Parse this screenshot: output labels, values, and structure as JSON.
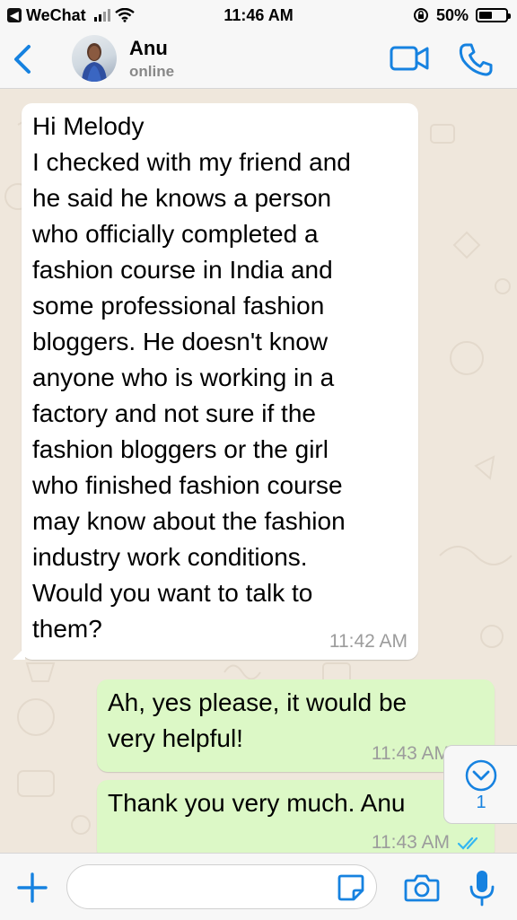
{
  "status_bar": {
    "carrier": "WeChat",
    "time": "11:46 AM",
    "battery": "50%",
    "battery_level": 0.5
  },
  "header": {
    "contact_name": "Anu",
    "contact_status": "online"
  },
  "messages": [
    {
      "direction": "incoming",
      "text": "Hi Melody\nI checked with my friend and\nhe said he knows a person\nwho officially completed a\nfashion course in India and\nsome professional fashion\nbloggers. He doesn't know\nanyone who is working in a\nfactory and not sure if the\nfashion bloggers or the girl\nwho finished fashion course\nmay know about the fashion\nindustry work conditions.\nWould you want to talk to\nthem?",
      "time": "11:42 AM"
    },
    {
      "direction": "outgoing",
      "text": "Ah, yes please, it would be\nvery helpful!",
      "time": "11:43 AM"
    },
    {
      "direction": "outgoing",
      "text": "Thank you very much. Anu",
      "time": "11:43 AM"
    }
  ],
  "scroll_down": {
    "unread_count": "1"
  },
  "input_bar": {
    "placeholder": ""
  },
  "colors": {
    "accent": "#1682e0",
    "incoming_bubble": "#ffffff",
    "outgoing_bubble": "#dcf8c6",
    "read_ticks": "#34b7f1"
  }
}
